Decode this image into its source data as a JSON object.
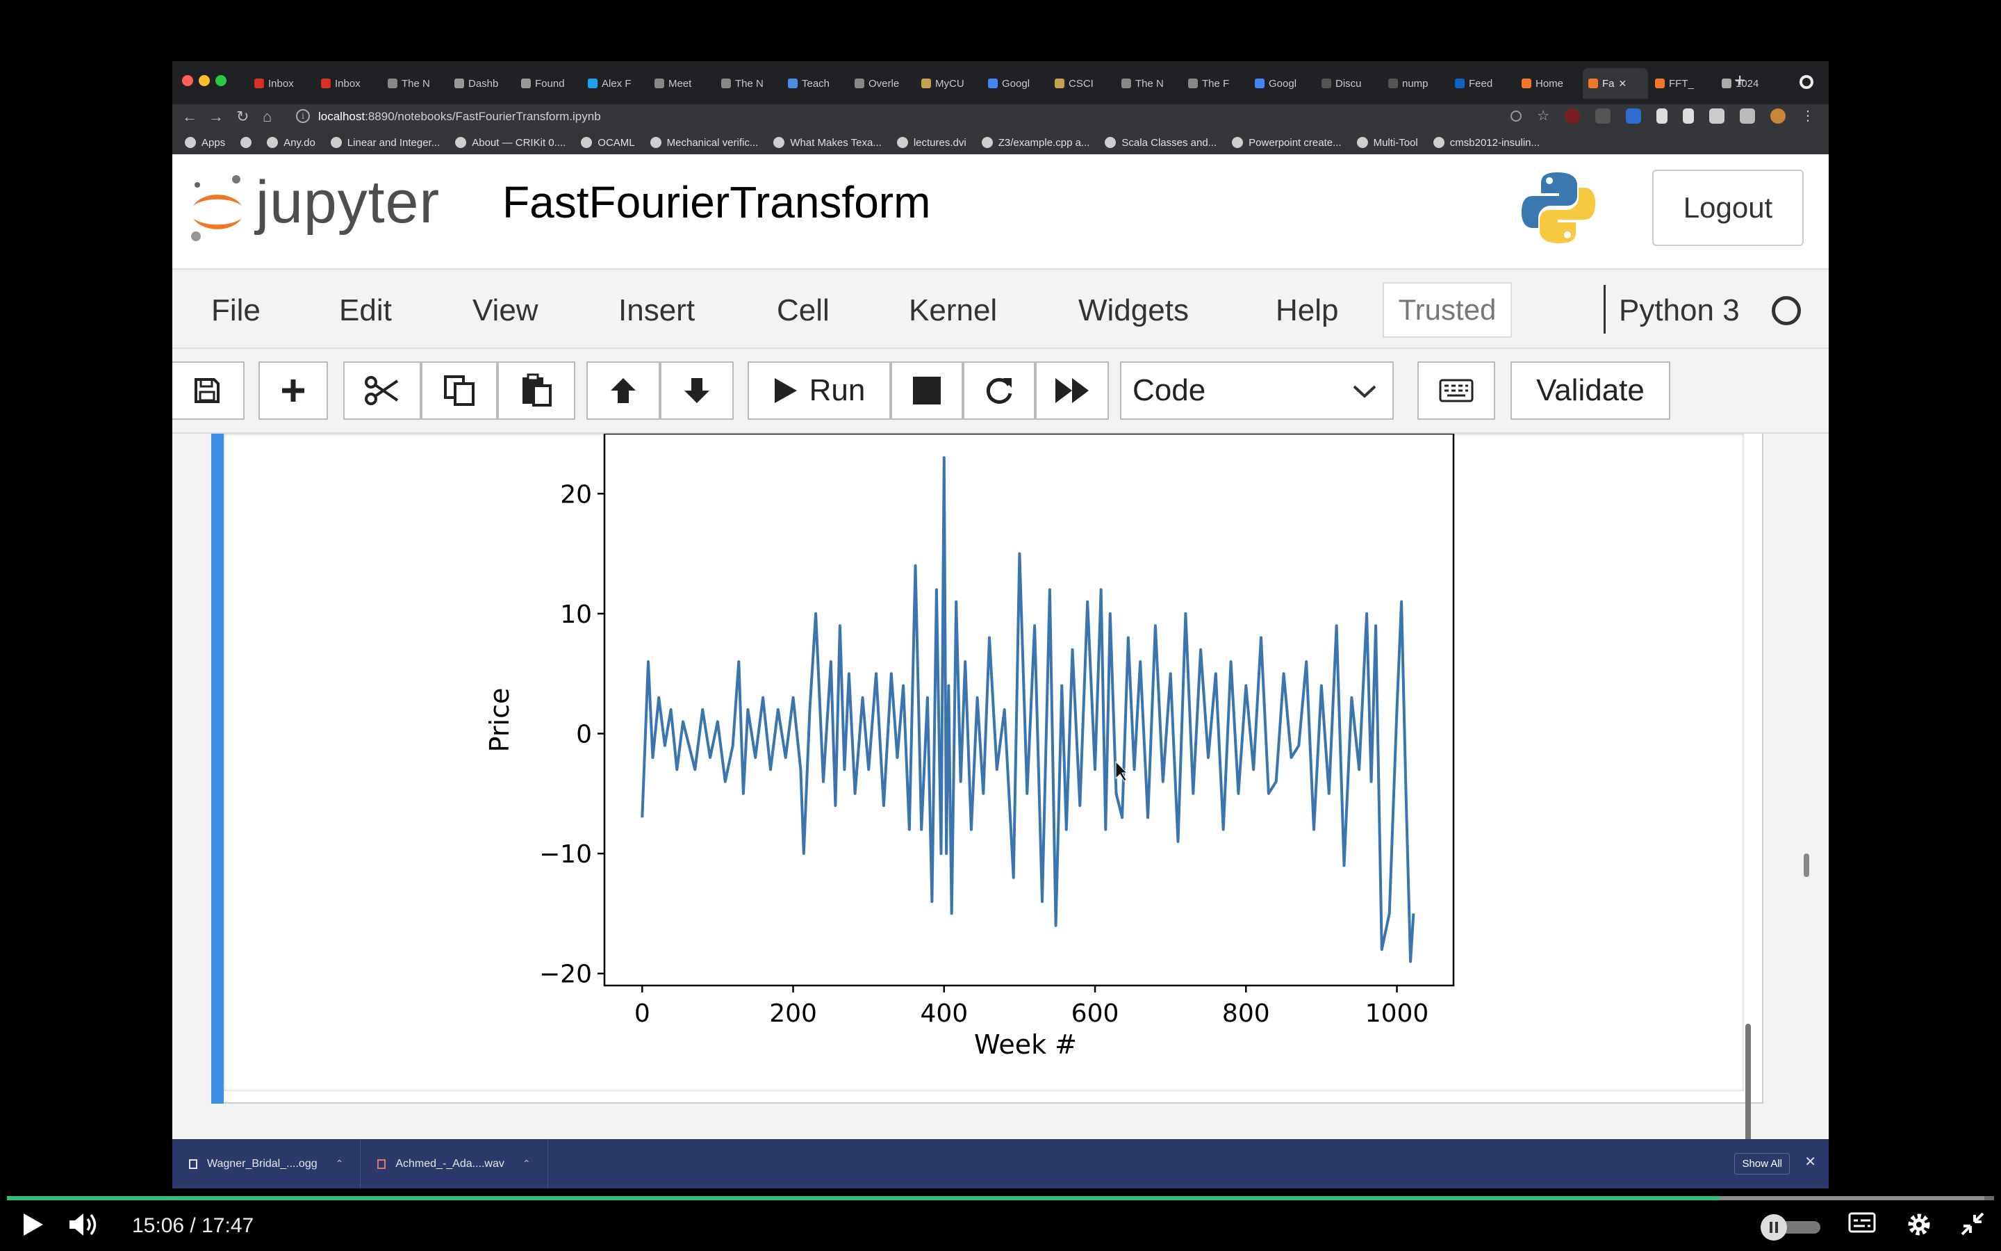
{
  "browser": {
    "tabs": [
      {
        "label": "Inbox",
        "color": "#d93025"
      },
      {
        "label": "Inbox",
        "color": "#d93025"
      },
      {
        "label": "The N",
        "color": "#888888"
      },
      {
        "label": "Dashb",
        "color": "#999999"
      },
      {
        "label": "Found",
        "color": "#999999"
      },
      {
        "label": "Alex F",
        "color": "#1da1f2"
      },
      {
        "label": "Meet",
        "color": "#888888"
      },
      {
        "label": "The N",
        "color": "#888888"
      },
      {
        "label": "Teach",
        "color": "#4a90e2"
      },
      {
        "label": "Overle",
        "color": "#888888"
      },
      {
        "label": "MyCU",
        "color": "#c8a14a"
      },
      {
        "label": "Googl",
        "color": "#4285f4"
      },
      {
        "label": "CSCI",
        "color": "#c8a14a"
      },
      {
        "label": "The N",
        "color": "#888888"
      },
      {
        "label": "The F",
        "color": "#888888"
      },
      {
        "label": "Googl",
        "color": "#4285f4"
      },
      {
        "label": "Discu",
        "color": "#555555"
      },
      {
        "label": "nump",
        "color": "#555555"
      },
      {
        "label": "Feed",
        "color": "#0a66c2"
      },
      {
        "label": "Home",
        "color": "#f37626"
      },
      {
        "label": "Fa",
        "color": "#f37626",
        "active": true
      },
      {
        "label": "FFT_",
        "color": "#f37626"
      },
      {
        "label": "1024",
        "color": "#aaaaaa"
      }
    ],
    "url_host": "localhost",
    "url_path": ":8890/notebooks/FastFourierTransform.ipynb",
    "bookmarks": [
      "Apps",
      "",
      "Any.do",
      "Linear and Integer...",
      "About — CRIKit 0....",
      "OCAML",
      "Mechanical verific...",
      "What Makes Texa...",
      "lectures.dvi",
      "Z3/example.cpp a...",
      "Scala Classes and...",
      "Powerpoint create...",
      "Multi-Tool",
      "cmsb2012-insulin..."
    ]
  },
  "jupyter": {
    "logo_text": "jupyter",
    "notebook_title": "FastFourierTransform",
    "logout": "Logout",
    "menu": [
      "File",
      "Edit",
      "View",
      "Insert",
      "Cell",
      "Kernel",
      "Widgets",
      "Help"
    ],
    "trusted": "Trusted",
    "kernel": "Python 3",
    "run_label": "Run",
    "cell_type": "Code",
    "validate": "Validate"
  },
  "chart_data": {
    "type": "line",
    "xlabel": "Week #",
    "ylabel": "Price",
    "xlim": [
      -50,
      1075
    ],
    "ylim": [
      -21,
      25
    ],
    "xticks": [
      0,
      200,
      400,
      600,
      800,
      1000
    ],
    "yticks": [
      -20,
      -10,
      0,
      10,
      20
    ],
    "line_color": "#3a75b0",
    "series": [
      {
        "x": [
          0,
          8,
          14,
          22,
          30,
          38,
          46,
          54,
          62,
          70,
          80,
          90,
          100,
          110,
          120,
          128,
          134,
          140,
          150,
          160,
          170,
          180,
          190,
          200,
          210,
          214,
          222,
          230,
          240,
          250,
          256,
          262,
          268,
          274,
          282,
          292,
          300,
          310,
          320,
          330,
          338,
          346,
          354,
          362,
          370,
          378,
          384,
          390,
          396,
          400,
          403,
          406,
          410,
          416,
          422,
          428,
          436,
          444,
          452,
          460,
          470,
          480,
          492,
          500,
          510,
          520,
          530,
          540,
          548,
          556,
          562,
          570,
          580,
          590,
          600,
          608,
          614,
          620,
          628,
          636,
          644,
          652,
          660,
          670,
          680,
          690,
          700,
          710,
          720,
          730,
          740,
          750,
          760,
          770,
          780,
          790,
          800,
          810,
          820,
          830,
          840,
          850,
          860,
          870,
          880,
          890,
          900,
          910,
          920,
          930,
          940,
          950,
          960,
          966,
          972,
          980,
          990,
          1000,
          1006,
          1012,
          1018,
          1022
        ],
        "y": [
          -7,
          6,
          -2,
          3,
          -1,
          2,
          -3,
          1,
          -1,
          -3,
          2,
          -2,
          1,
          -4,
          -1,
          6,
          -5,
          2,
          -2,
          3,
          -3,
          2,
          -2,
          3,
          -3,
          -10,
          2,
          10,
          -4,
          6,
          -6,
          9,
          -3,
          5,
          -5,
          3,
          -3,
          5,
          -6,
          5,
          -2,
          4,
          -8,
          14,
          -8,
          3,
          -14,
          12,
          -10,
          23,
          -10,
          4,
          -15,
          11,
          -4,
          6,
          -8,
          3,
          -5,
          8,
          -3,
          2,
          -12,
          15,
          -5,
          9,
          -14,
          12,
          -16,
          4,
          -8,
          7,
          -6,
          11,
          -3,
          12,
          -8,
          10,
          -5,
          -7,
          8,
          -3,
          6,
          -7,
          9,
          -4,
          5,
          -9,
          10,
          -5,
          7,
          -2,
          5,
          -8,
          6,
          -5,
          4,
          -3,
          8,
          -5,
          -4,
          5,
          -2,
          -1,
          6,
          -8,
          4,
          -5,
          9,
          -11,
          3,
          -3,
          10,
          -4,
          9,
          -18,
          -15,
          2,
          11,
          -5,
          -19,
          -15
        ]
      }
    ]
  },
  "downloads": [
    {
      "name": "Wagner_Bridal_....ogg"
    },
    {
      "name": "Achmed_-_Ada....wav"
    }
  ],
  "downloads_show_all": "Show All",
  "player": {
    "current_time": "15:06",
    "separator": "/",
    "duration": "17:47",
    "progress_fraction": 0.8624,
    "buffered_end_fraction": 0.995
  }
}
